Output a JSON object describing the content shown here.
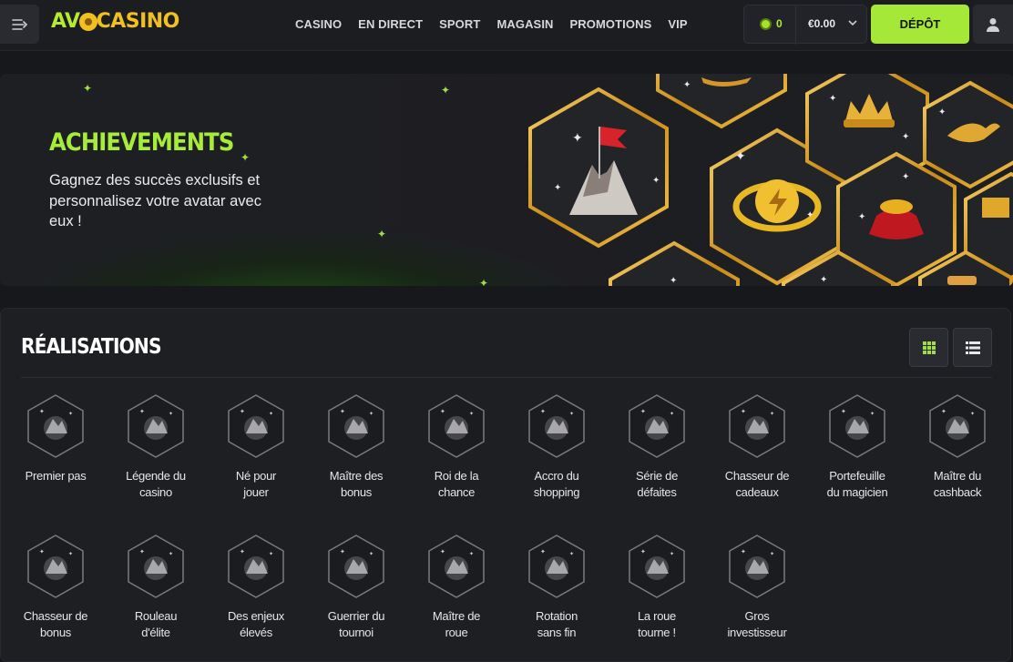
{
  "header": {
    "logo_left": "AVO",
    "logo_right": "CASINO",
    "nav": [
      "CASINO",
      "EN DIRECT",
      "SPORT",
      "MAGASIN",
      "PROMOTIONS",
      "VIP"
    ],
    "coins": "0",
    "balance": "€0.00",
    "deposit_label": "DÉPÔT",
    "icons": {
      "menu": "menu-collapse-icon",
      "user": "user-icon",
      "chevron": "chevron-down-icon",
      "coin": "coin-icon"
    }
  },
  "banner": {
    "title": "ACHIEVEMENTS",
    "subtitle": "Gagnez des succès exclusifs et personnalisez votre avatar avec eux !"
  },
  "achievements": {
    "title": "RÉALISATIONS",
    "view_icons": [
      "grid-view-icon",
      "list-view-icon"
    ],
    "items": [
      {
        "label1": "Premier pas",
        "label2": "",
        "icon": "mountain-flag-icon"
      },
      {
        "label1": "Légende du",
        "label2": "casino",
        "icon": "crown-icon"
      },
      {
        "label1": "Né pour",
        "label2": "jouer",
        "icon": "target-icon"
      },
      {
        "label1": "Maître des",
        "label2": "bonus",
        "icon": "treasure-icon"
      },
      {
        "label1": "Roi de la",
        "label2": "chance",
        "icon": "lucky-king-icon"
      },
      {
        "label1": "Accro du",
        "label2": "shopping",
        "icon": "shopping-bag-icon"
      },
      {
        "label1": "Série de",
        "label2": "défaites",
        "icon": "dice-icon"
      },
      {
        "label1": "Chasseur de",
        "label2": "cadeaux",
        "icon": "bow-arrow-icon"
      },
      {
        "label1": "Portefeuille",
        "label2": "du magicien",
        "icon": "magic-cauldron-icon"
      },
      {
        "label1": "Maître du",
        "label2": "cashback",
        "icon": "cashback-ring-icon"
      },
      {
        "label1": "Chasseur de",
        "label2": "bonus",
        "icon": "knight-icon"
      },
      {
        "label1": "Rouleau",
        "label2": "d'élite",
        "icon": "hooded-warrior-icon"
      },
      {
        "label1": "Des enjeux",
        "label2": "élevés",
        "icon": "coin-stacks-icon"
      },
      {
        "label1": "Guerrier du",
        "label2": "tournoi",
        "icon": "trophy-icon"
      },
      {
        "label1": "Maître de",
        "label2": "roue",
        "icon": "slot-machine-icon"
      },
      {
        "label1": "Rotation",
        "label2": "sans fin",
        "icon": "infinity-icon"
      },
      {
        "label1": "La roue",
        "label2": "tourne !",
        "icon": "wheel-icon"
      },
      {
        "label1": "Gros",
        "label2": "investisseur",
        "icon": "safe-icon"
      }
    ]
  }
}
